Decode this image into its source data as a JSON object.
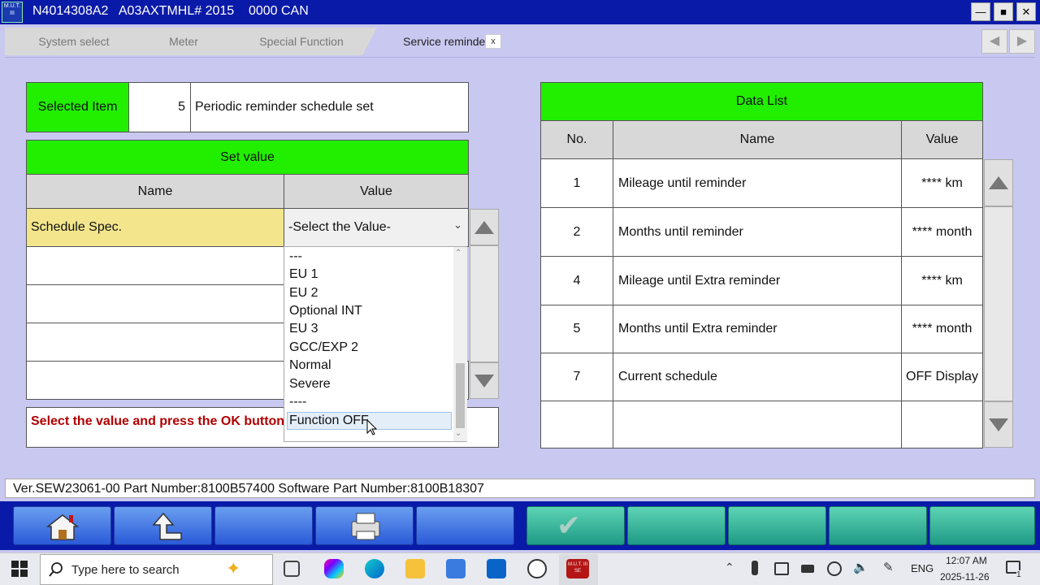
{
  "window": {
    "title": "N4014308A2   A03AXTMHL# 2015    0000 CAN",
    "logo_text": "M.U.T. III",
    "minimize": "—",
    "maximize": "■",
    "close": "✕"
  },
  "tabs": [
    {
      "label": "System select"
    },
    {
      "label": "Meter"
    },
    {
      "label": "Special Function"
    },
    {
      "label": "Service reminder",
      "close": "x"
    }
  ],
  "nav": {
    "prev": "◀",
    "next": "▶"
  },
  "selected": {
    "label": "Selected Item",
    "number": "5",
    "name": "Periodic reminder schedule set"
  },
  "set_value": {
    "title": "Set value",
    "headers": {
      "name": "Name",
      "value": "Value"
    },
    "row": {
      "name": "Schedule Spec.",
      "value": "-Select the Value-"
    },
    "chevron": "⌄"
  },
  "dropdown": {
    "options": [
      "---",
      "EU 1",
      "EU 2",
      "Optional INT",
      "EU 3",
      "GCC/EXP 2",
      "Normal",
      "Severe",
      "----",
      "Function OFF"
    ],
    "highlighted": "Function OFF"
  },
  "message": "Select the value and press the OK button",
  "data_list": {
    "title": "Data List",
    "headers": {
      "no": "No.",
      "name": "Name",
      "value": "Value"
    },
    "rows": [
      {
        "no": "1",
        "name": "Mileage until reminder",
        "value": "**** km"
      },
      {
        "no": "2",
        "name": "Months until reminder",
        "value": "**** month"
      },
      {
        "no": "4",
        "name": "Mileage until Extra reminder",
        "value": "**** km"
      },
      {
        "no": "5",
        "name": "Months until Extra reminder",
        "value": "**** month"
      },
      {
        "no": "7",
        "name": "Current schedule",
        "value": "OFF Display"
      }
    ]
  },
  "status": "Ver.SEW23061-00 Part Number:8100B57400 Software Part Number:8100B18307",
  "toolbar": {
    "ok_glyph": "✔"
  },
  "taskbar": {
    "search_placeholder": "Type here to search",
    "language": "ENG",
    "time": "12:07 AM",
    "date": "2025-11-26",
    "notifications": "1",
    "app_label": "M.U.T. III SE"
  },
  "colors": {
    "title_bar": "#0a1aa8",
    "header_green": "#22ee00",
    "selected_yellow": "#f2e58c",
    "message_red": "#b00000"
  }
}
